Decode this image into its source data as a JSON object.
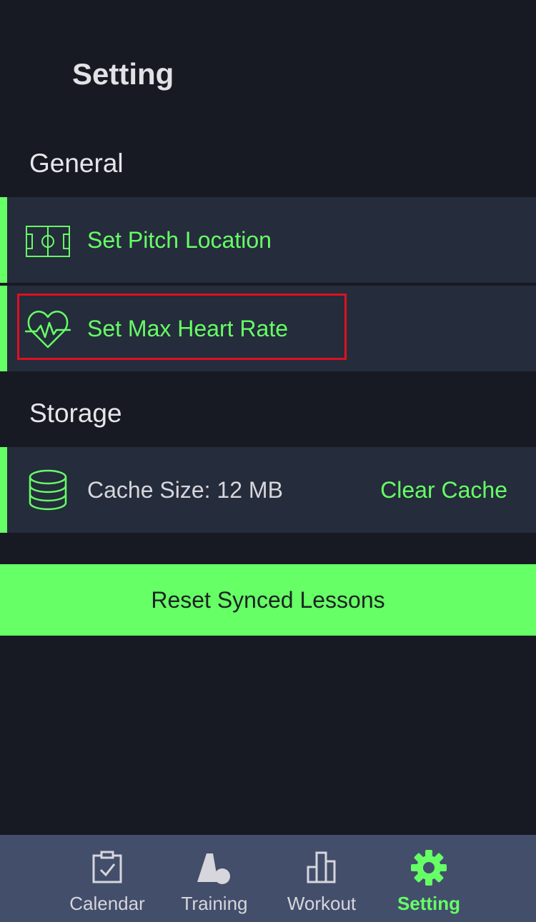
{
  "header": {
    "title": "Setting"
  },
  "sections": {
    "general": {
      "title": "General",
      "items": [
        {
          "label": "Set Pitch Location",
          "icon": "pitch-icon"
        },
        {
          "label": "Set Max Heart Rate",
          "icon": "heart-rate-icon"
        }
      ]
    },
    "storage": {
      "title": "Storage",
      "cache_label": "Cache Size: 12 MB",
      "cache_icon": "database-icon",
      "clear_label": "Clear Cache"
    }
  },
  "actions": {
    "reset_label": "Reset Synced Lessons"
  },
  "tabbar": {
    "tabs": [
      {
        "label": "Calendar",
        "icon": "calendar-check-icon",
        "active": false
      },
      {
        "label": "Training",
        "icon": "training-cone-icon",
        "active": false
      },
      {
        "label": "Workout",
        "icon": "bar-chart-icon",
        "active": false
      },
      {
        "label": "Setting",
        "icon": "gear-icon",
        "active": true
      }
    ]
  },
  "colors": {
    "accent": "#66ff66",
    "background": "#171a23",
    "row_background": "#252c3b",
    "tabbar_background": "#434e6b",
    "highlight": "#e01020"
  }
}
